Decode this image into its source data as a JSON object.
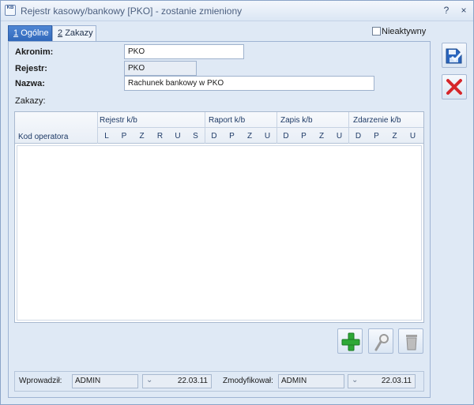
{
  "window": {
    "title": "Rejestr kasowy/bankowy [PKO] - zostanie zmieniony",
    "app_icon_text": "KB",
    "help_label": "?",
    "close_label": "×"
  },
  "tabs": [
    {
      "num": "1",
      "label": "Ogólne",
      "active": true
    },
    {
      "num": "2",
      "label": "Zakazy",
      "active": false
    }
  ],
  "inactive_checkbox": {
    "label": "Nieaktywny",
    "checked": false
  },
  "form": {
    "akronim_label": "Akronim:",
    "akronim_value": "PKO",
    "rejestr_label": "Rejestr:",
    "rejestr_value": "PKO",
    "nazwa_label": "Nazwa:",
    "nazwa_value": "Rachunek bankowy w PKO",
    "zakazy_label": "Zakazy:"
  },
  "grid": {
    "groups": [
      "Rejestr k/b",
      "Raport k/b",
      "Zapis k/b",
      "Zdarzenie k/b"
    ],
    "kod_header": "Kod operatora",
    "rejestr_cols": [
      "L",
      "P",
      "Z",
      "R",
      "U",
      "S"
    ],
    "raport_cols": [
      "D",
      "P",
      "Z",
      "U"
    ],
    "zapis_cols": [
      "D",
      "P",
      "Z",
      "U"
    ],
    "zdarzenie_cols": [
      "D",
      "P",
      "Z",
      "U"
    ],
    "rows": []
  },
  "footer": {
    "wprowadzil_label": "Wprowadził:",
    "wprowadzil_user": "ADMIN",
    "wprowadzil_date": "22.03.11",
    "zmodyfikowal_label": "Zmodyfikował:",
    "zmodyfikowal_user": "ADMIN",
    "zmodyfikowal_date": "22.03.11",
    "dropdown_symbol": "⌄"
  },
  "icons": {
    "save": "save-icon",
    "cancel": "cancel-icon",
    "add": "add-icon",
    "edit": "magnifier-icon",
    "delete": "trash-icon"
  },
  "colors": {
    "accent": "#2f67b9",
    "cancel_red": "#d6262a",
    "add_green": "#2ea836"
  }
}
